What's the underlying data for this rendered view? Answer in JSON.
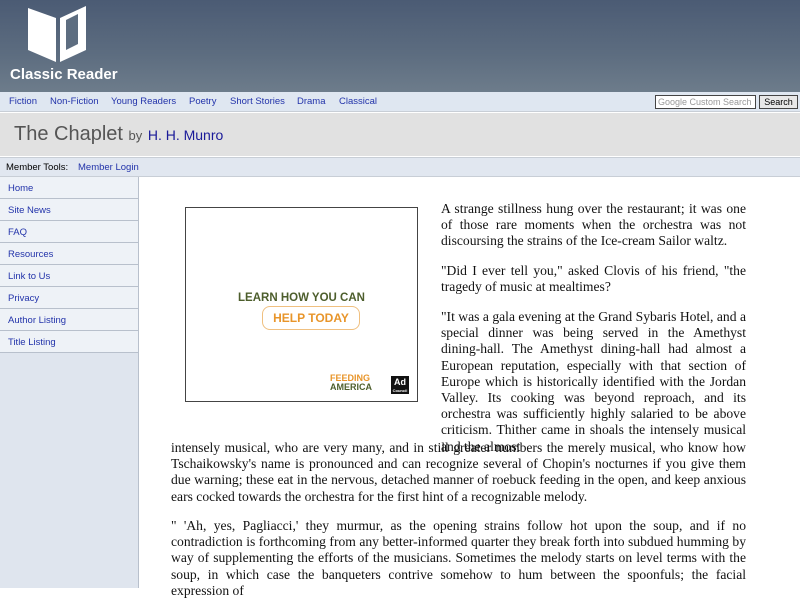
{
  "site": {
    "name": "Classic Reader"
  },
  "nav": [
    "Fiction",
    "Non-Fiction",
    "Young Readers",
    "Poetry",
    "Short Stories",
    "Drama",
    "Classical"
  ],
  "search": {
    "placeholder": "Google Custom Search",
    "button": "Search"
  },
  "book": {
    "title": "The Chaplet",
    "by": "by",
    "author": "H. H. Munro"
  },
  "member_tools": {
    "label": "Member Tools:",
    "login": "Member Login"
  },
  "sidebar": [
    "Home",
    "Site News",
    "FAQ",
    "Resources",
    "Link to Us",
    "Privacy",
    "Author Listing",
    "Title Listing"
  ],
  "ad": {
    "line1": "LEARN HOW YOU CAN",
    "line2": "HELP TODAY",
    "brand1": "FEEDING",
    "brand2": "AMERICA",
    "council": "Ad Council"
  },
  "text": {
    "p1": "A strange stillness hung over the restaurant; it was one of those rare moments when the orchestra was not discoursing the strains of the Ice-cream Sailor waltz.",
    "p2": "\"Did I ever tell you,\" asked Clovis of his friend, \"the tragedy of music at mealtimes?",
    "p3a": "\"It was a gala evening at the Grand Sybaris Hotel, and a special dinner was being served in the Amethyst dining-hall. The Amethyst dining-hall had almost a European reputation, especially with that section of Europe which is historically identified with the Jordan Valley. Its cooking was beyond reproach, and its orchestra was sufficiently highly salaried to be above criticism. Thither came in shoals the intensely musical and the almost",
    "p3b": "intensely musical, who are very many, and in still greater numbers the merely musical, who know how Tschaikowsky's name is pronounced and can recognize several of Chopin's nocturnes if you give them due warning; these eat in the nervous, detached manner of roebuck feeding in the open, and keep anxious ears cocked towards the orchestra for the first hint of a recognizable melody.",
    "p4": "\" 'Ah, yes, Pagliacci,' they murmur, as the opening strains follow hot upon the soup, and if no contradiction is forthcoming from any better-informed quarter they break forth into subdued humming by way of supplementing the efforts of the musicians. Sometimes the melody starts on level terms with the soup, in which case the banqueters contrive somehow to hum between the spoonfuls; the facial expression of"
  }
}
